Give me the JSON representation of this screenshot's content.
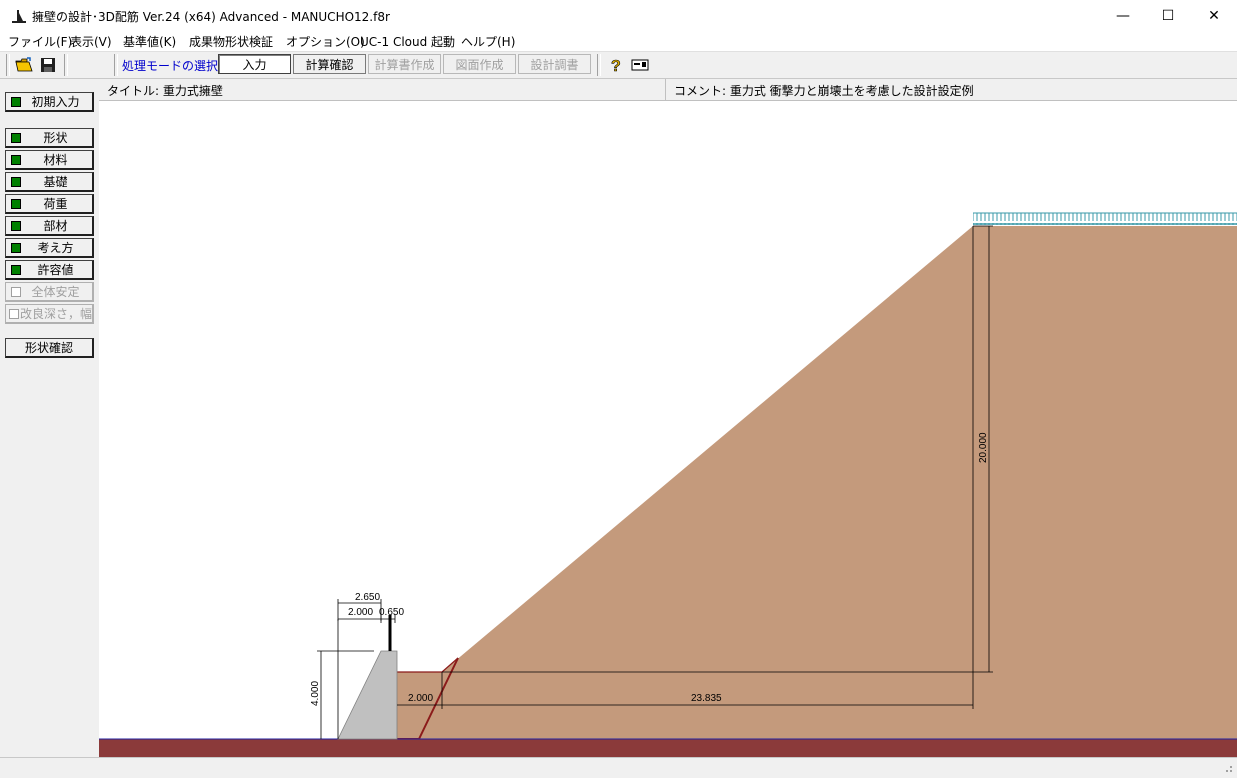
{
  "window": {
    "title": "擁壁の設計･3D配筋 Ver.24 (x64) Advanced  - MANUCHO12.f8r",
    "controls": {
      "minimize": "—",
      "maximize": "☐",
      "close": "✕"
    }
  },
  "menu": [
    "ファイル(F)",
    "表示(V)",
    "基準値(K)",
    "成果物形状検証",
    "オプション(O)",
    "UC-1 Cloud 起動",
    "ヘルプ(H)"
  ],
  "toolbar": {
    "icons": [
      "open-folder-icon",
      "save-disk-icon",
      "help-icon",
      "card-icon"
    ],
    "mode_label": "処理モードの選択",
    "modes": [
      {
        "label": "入力",
        "state": "pressed"
      },
      {
        "label": "計算確認",
        "state": "normal"
      },
      {
        "label": "計算書作成",
        "state": "disabled"
      },
      {
        "label": "図面作成",
        "state": "disabled"
      },
      {
        "label": "設計調書",
        "state": "disabled"
      }
    ]
  },
  "sidebar": {
    "initial": {
      "label": "初期入力",
      "checked": true
    },
    "items": [
      {
        "label": "形状",
        "checked": true,
        "enabled": true
      },
      {
        "label": "材料",
        "checked": true,
        "enabled": true
      },
      {
        "label": "基礎",
        "checked": true,
        "enabled": true
      },
      {
        "label": "荷重",
        "checked": true,
        "enabled": true
      },
      {
        "label": "部材",
        "checked": true,
        "enabled": true
      },
      {
        "label": "考え方",
        "checked": true,
        "enabled": true
      },
      {
        "label": "許容値",
        "checked": true,
        "enabled": true
      },
      {
        "label": "全体安定",
        "checked": false,
        "enabled": false
      },
      {
        "label": "改良深さ，幅",
        "checked": false,
        "enabled": false
      }
    ],
    "confirm": "形状確認"
  },
  "info": {
    "title": "タイトル:  重力式擁壁",
    "comment": "コメント:  重力式 衝撃力と崩壊土を考慮した設計設定例"
  },
  "drawing": {
    "dimensions": {
      "top_total": "2.650",
      "top_left": "2.000",
      "top_right": "0.650",
      "wall_height": "4.000",
      "slope_height": "20.000",
      "gap": "2.000",
      "slope_width": "23.835"
    },
    "colors": {
      "soil": "#c49a7c",
      "ground": "#8b3a3a",
      "wall": "#c0c0c0",
      "surcharge": "#3a9aa8",
      "outline": "#8b1a1a"
    }
  }
}
